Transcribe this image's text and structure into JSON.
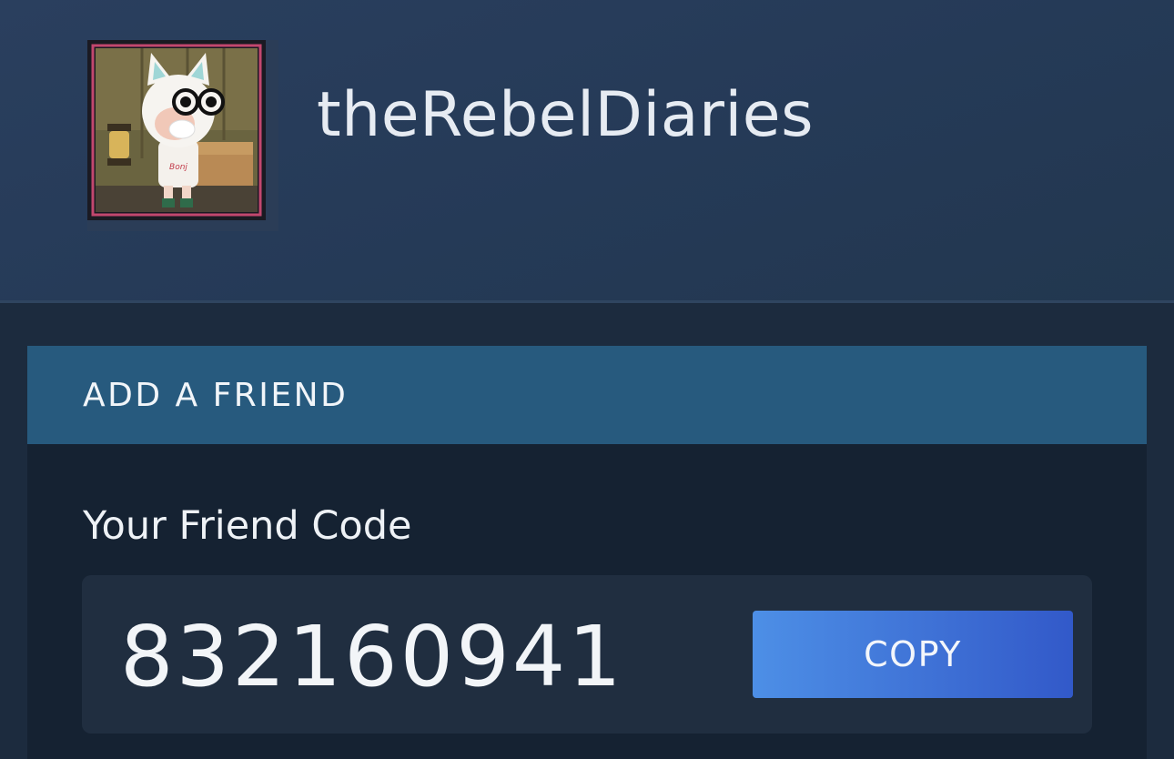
{
  "profile": {
    "username": "theRebelDiaries",
    "avatar_icon": "avatar-image"
  },
  "add_friend": {
    "title": "ADD A FRIEND",
    "code_label": "Your Friend Code",
    "friend_code": "832160941",
    "copy_label": "COPY"
  },
  "colors": {
    "header_bg": "#253a57",
    "panel_header_bg": "#275a7e",
    "panel_bg": "#152232",
    "copy_button_start": "#4d8fe6",
    "copy_button_end": "#3259c9"
  }
}
